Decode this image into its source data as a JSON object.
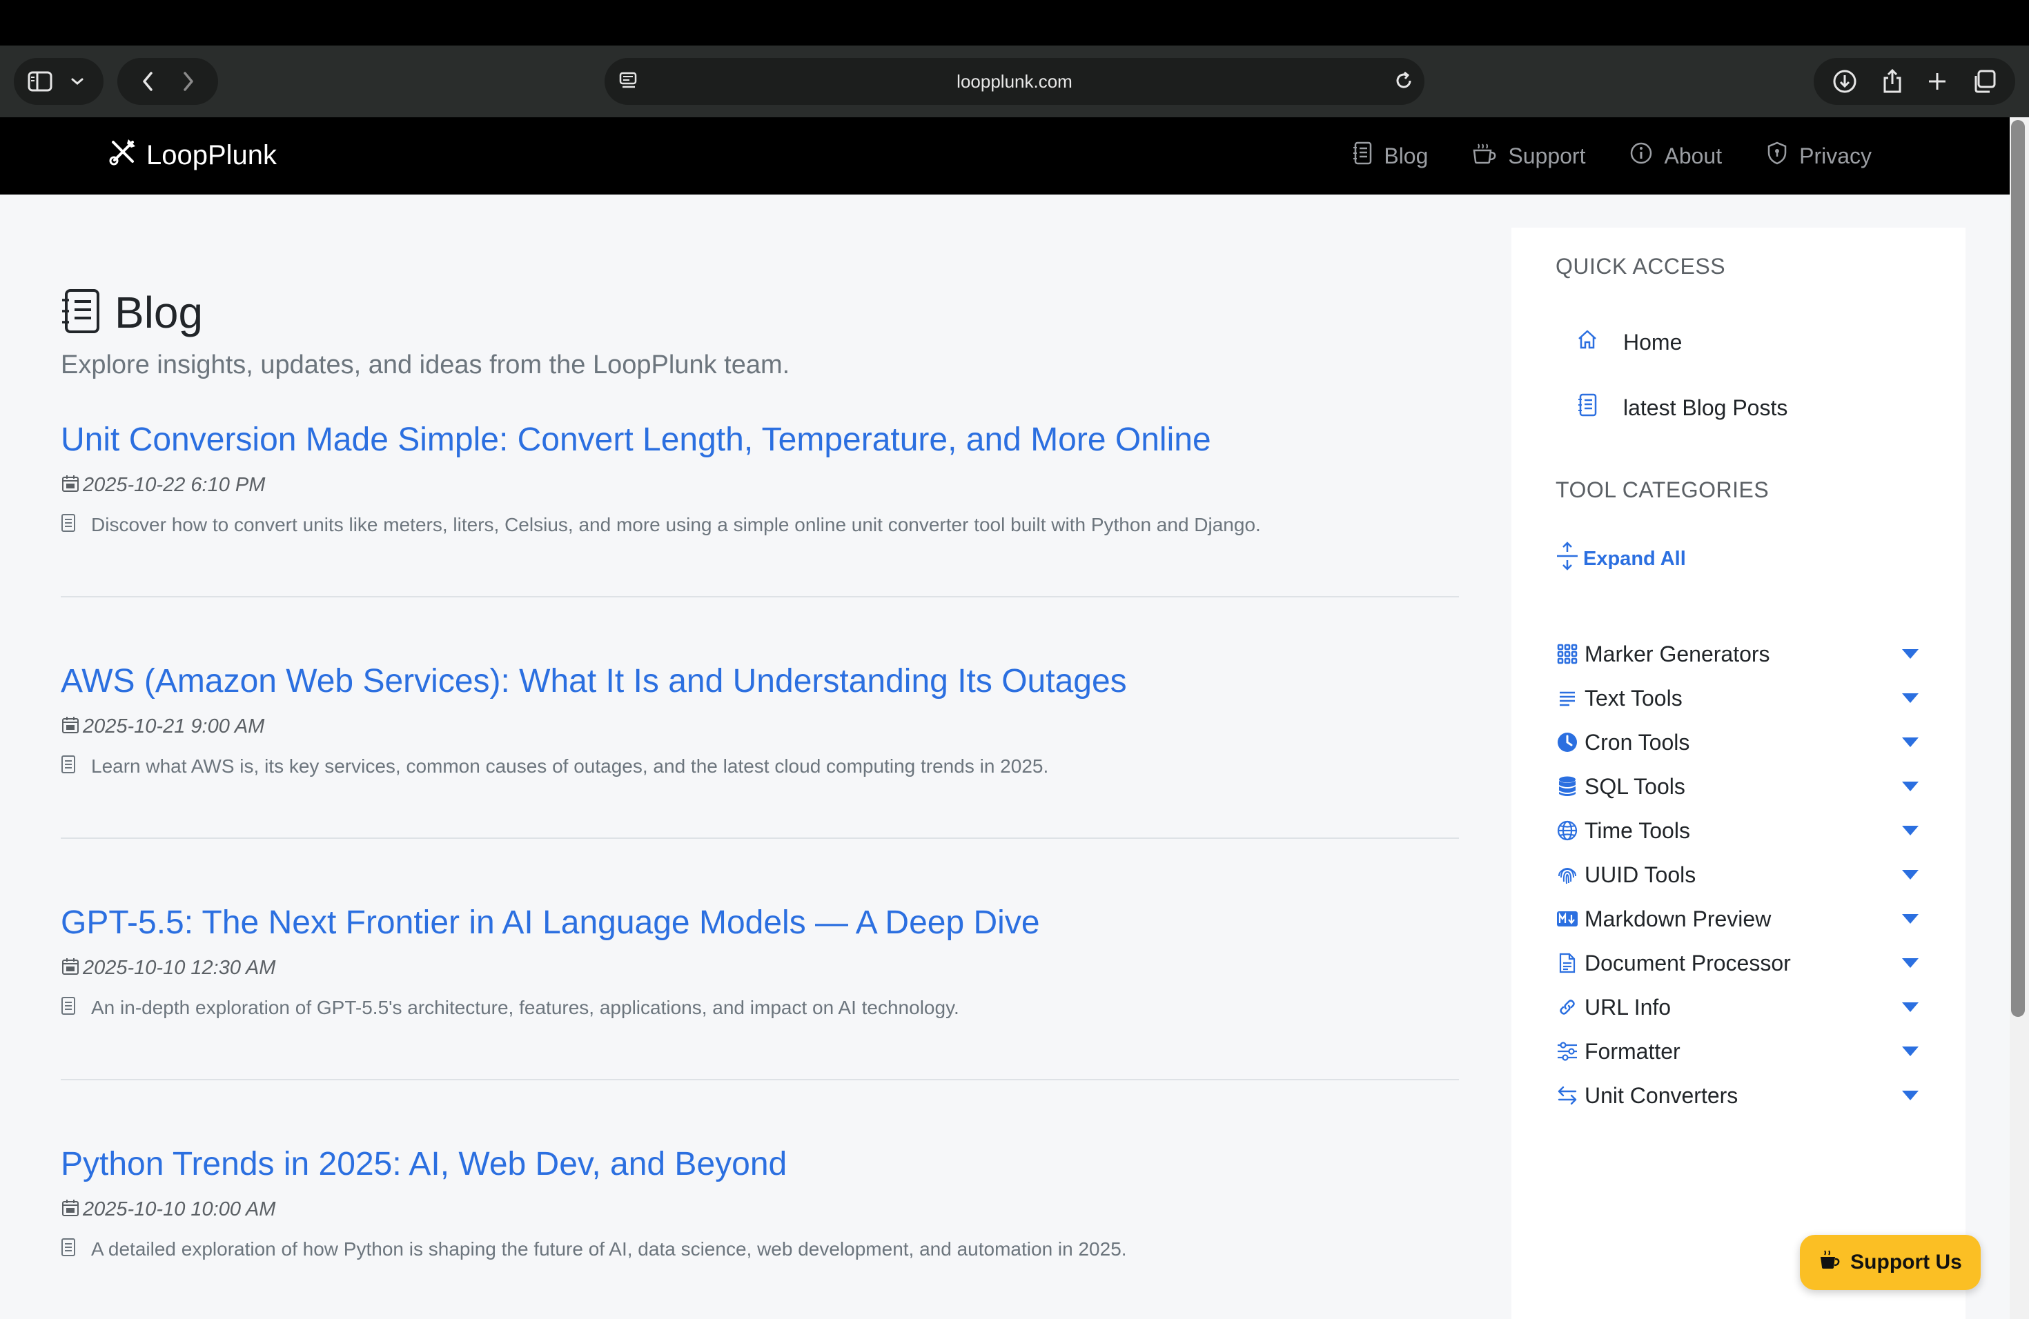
{
  "browser": {
    "url": "loopplunk.com"
  },
  "site": {
    "brand": "LoopPlunk",
    "nav": [
      {
        "label": "Blog",
        "icon": "journal-icon"
      },
      {
        "label": "Support",
        "icon": "coffee-icon"
      },
      {
        "label": "About",
        "icon": "info-icon"
      },
      {
        "label": "Privacy",
        "icon": "shield-icon"
      }
    ]
  },
  "page": {
    "title": "Blog",
    "subtitle": "Explore insights, updates, and ideas from the LoopPlunk team."
  },
  "posts": [
    {
      "title": "Unit Conversion Made Simple: Convert Length, Temperature, and More Online",
      "date": "2025-10-22 6:10 PM",
      "description": "Discover how to convert units like meters, liters, Celsius, and more using a simple online unit converter tool built with Python and Django."
    },
    {
      "title": "AWS (Amazon Web Services): What It Is and Understanding Its Outages",
      "date": "2025-10-21 9:00 AM",
      "description": "Learn what AWS is, its key services, common causes of outages, and the latest cloud computing trends in 2025."
    },
    {
      "title": "GPT-5.5: The Next Frontier in AI Language Models — A Deep Dive",
      "date": "2025-10-10 12:30 AM",
      "description": "An in-depth exploration of GPT-5.5's architecture, features, applications, and impact on AI technology."
    },
    {
      "title": "Python Trends in 2025: AI, Web Dev, and Beyond",
      "date": "2025-10-10 10:00 AM",
      "description": "A detailed exploration of how Python is shaping the future of AI, data science, web development, and automation in 2025."
    }
  ],
  "sidebar": {
    "quick_access_heading": "QUICK ACCESS",
    "quick_access": [
      {
        "label": "Home",
        "icon": "home-icon"
      },
      {
        "label": "latest Blog Posts",
        "icon": "journal-icon"
      }
    ],
    "categories_heading": "TOOL CATEGORIES",
    "expand_all": "Expand All",
    "categories": [
      {
        "label": "Marker Generators",
        "icon": "grid-icon"
      },
      {
        "label": "Text Tools",
        "icon": "text-lines-icon"
      },
      {
        "label": "Cron Tools",
        "icon": "clock-icon"
      },
      {
        "label": "SQL Tools",
        "icon": "database-icon"
      },
      {
        "label": "Time Tools",
        "icon": "globe-icon"
      },
      {
        "label": "UUID Tools",
        "icon": "fingerprint-icon"
      },
      {
        "label": "Markdown Preview",
        "icon": "markdown-icon"
      },
      {
        "label": "Document Processor",
        "icon": "document-icon"
      },
      {
        "label": "URL Info",
        "icon": "link-icon"
      },
      {
        "label": "Formatter",
        "icon": "sliders-icon"
      },
      {
        "label": "Unit Converters",
        "icon": "arrows-exchange-icon"
      }
    ]
  },
  "support_button": {
    "label": "Support Us",
    "icon": "coffee-icon"
  },
  "colors": {
    "accent": "#2b6fe0",
    "support": "#fbbf24",
    "header_bg": "#000000",
    "content_bg": "#f6f7f9"
  }
}
